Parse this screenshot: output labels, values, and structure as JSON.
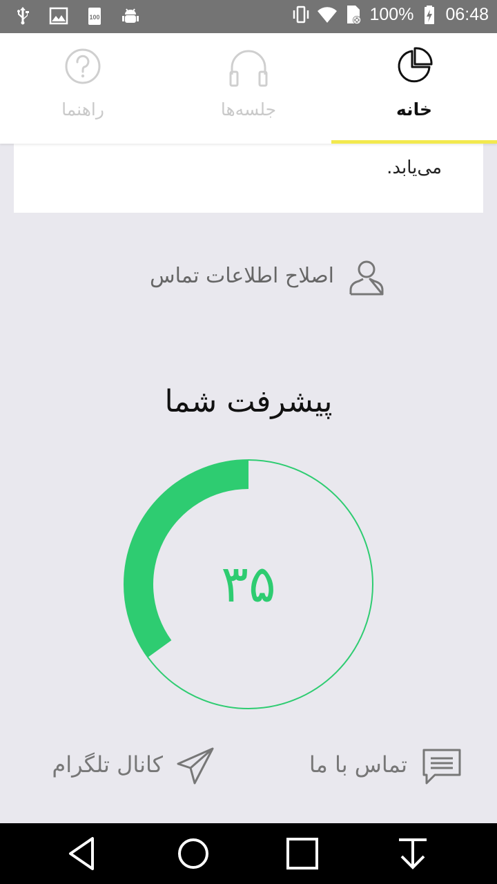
{
  "status_bar": {
    "battery": "100%",
    "time": "06:48",
    "left_icons": [
      "usb-icon",
      "image-icon",
      "storage-100-icon",
      "android-debug-icon"
    ],
    "right_icons": [
      "vibrate-icon",
      "wifi-icon",
      "sim-off-icon",
      "battery-charging-icon"
    ]
  },
  "tabs": [
    {
      "id": "home",
      "label": "خانه",
      "icon": "pie-chart-icon",
      "active": true
    },
    {
      "id": "sessions",
      "label": "جلسه‌ها",
      "icon": "headphones-icon",
      "active": false
    },
    {
      "id": "guide",
      "label": "راهنما",
      "icon": "help-circle-icon",
      "active": false
    }
  ],
  "card": {
    "text_end": "می‌یابد."
  },
  "edit_contact": {
    "label": "اصلاح اطلاعات تماس",
    "icon": "user-icon"
  },
  "progress": {
    "title": "پیشرفت شما",
    "value_text": "۳۵",
    "value": 35,
    "max": 100,
    "color": "#2ecc71"
  },
  "links": {
    "contact_us": {
      "label": "تماس با ما",
      "icon": "message-icon"
    },
    "telegram": {
      "label": "کانال تلگرام",
      "icon": "send-icon"
    }
  },
  "colors": {
    "accent": "#f2e94e",
    "progress": "#2ecc71",
    "background": "#e9e8ee"
  }
}
